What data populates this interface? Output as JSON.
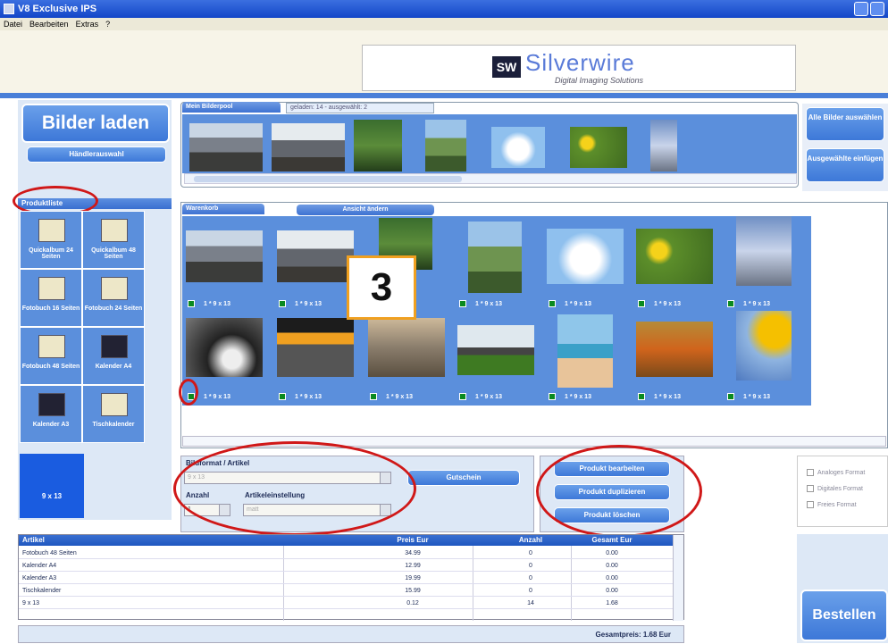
{
  "window": {
    "title": "V8 Exclusive IPS"
  },
  "menu": [
    "Datei",
    "Bearbeiten",
    "Extras",
    "?"
  ],
  "logo": {
    "mark": "SW",
    "brand": "Silverwire",
    "tagline": "Digital Imaging Solutions"
  },
  "left": {
    "load_button": "Bilder laden",
    "dealer_button": "Händlerauswahl",
    "product_list_title": "Produktliste",
    "products": [
      {
        "label": "Quickalbum 24 Seiten",
        "icon": "album-icon"
      },
      {
        "label": "Quickalbum 48 Seiten",
        "icon": "album-icon"
      },
      {
        "label": "Fotobuch 16 Seiten",
        "icon": "photobook-icon"
      },
      {
        "label": "Fotobuch 24 Seiten",
        "icon": "photobook-icon"
      },
      {
        "label": "Fotobuch 48 Seiten",
        "icon": "photobook-icon"
      },
      {
        "label": "Kalender A4",
        "icon": "calendar-icon"
      },
      {
        "label": "Kalender A3",
        "icon": "calendar-icon"
      },
      {
        "label": "Tischkalender",
        "icon": "desk-calendar-icon"
      }
    ],
    "selected_product": "9 x 13"
  },
  "pool": {
    "tab": "Mein Bilderpool",
    "status": "geladen: 14 - ausgewählt: 2"
  },
  "right_buttons": {
    "select_all": "Alle Bilder auswählen",
    "insert_selected": "Ausgewählte einfügen"
  },
  "cart": {
    "tab": "Warenkorb",
    "view_tab": "Ansicht ändern",
    "item_label": "1 * 9 x 13",
    "badge": "3"
  },
  "format": {
    "title": "Bildformat / Artikel",
    "format_value": "9 x 13",
    "voucher_button": "Gutschein",
    "quantity_label": "Anzahl",
    "quantity_value": "1",
    "setting_label": "Artikeleinstellung",
    "setting_value": "matt"
  },
  "product_buttons": [
    "Produkt bearbeiten",
    "Produkt duplizieren",
    "Produkt löschen"
  ],
  "format_options": [
    "Analoges Format",
    "Digitales Format",
    "Freies Format"
  ],
  "table": {
    "headers": [
      "Artikel",
      "Preis Eur",
      "Anzahl",
      "Gesamt Eur"
    ],
    "rows": [
      [
        "Fotobuch 48 Seiten",
        "34.99",
        "0",
        "0.00"
      ],
      [
        "Kalender A4",
        "12.99",
        "0",
        "0.00"
      ],
      [
        "Kalender A3",
        "19.99",
        "0",
        "0.00"
      ],
      [
        "Tischkalender",
        "15.99",
        "0",
        "0.00"
      ],
      [
        "9 x 13",
        "0.12",
        "14",
        "1.68"
      ]
    ],
    "total": "Gesamtpreis: 1.68 Eur"
  },
  "order_button": "Bestellen",
  "colors": {
    "accent": "#3d78d8",
    "panel": "#5b8fdc",
    "highlight": "#d01818",
    "badge_border": "#f0a020"
  }
}
